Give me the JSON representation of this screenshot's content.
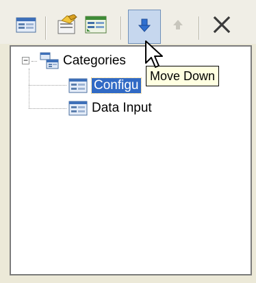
{
  "toolbar": {
    "buttons": [
      {
        "name": "form-icon",
        "pressed": false,
        "enabled": true
      },
      {
        "name": "properties-icon",
        "pressed": false,
        "enabled": true
      },
      {
        "name": "category-icon",
        "pressed": false,
        "enabled": true
      },
      {
        "name": "arrow-down-icon",
        "pressed": true,
        "enabled": true
      },
      {
        "name": "arrow-up-icon",
        "pressed": false,
        "enabled": false
      },
      {
        "name": "close-icon",
        "pressed": false,
        "enabled": true
      }
    ]
  },
  "tree": {
    "root": {
      "label": "Categories",
      "expander": "−"
    },
    "children": [
      {
        "label": "Configu",
        "selected": true
      },
      {
        "label": "Data Input",
        "selected": false
      }
    ]
  },
  "tooltip": {
    "text": "Move Down"
  },
  "colors": {
    "selection": "#316ac5",
    "tooltip_bg": "#ffffe1",
    "pressed_bg": "#c6d7ee",
    "arrow_blue": "#2f6fd0"
  }
}
